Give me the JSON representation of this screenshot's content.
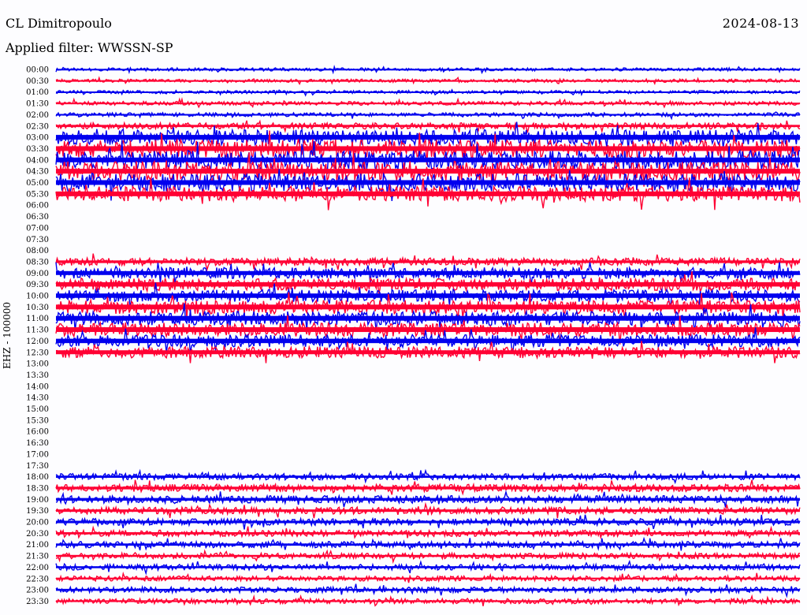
{
  "header": {
    "station": "CL Dimitropoulo",
    "date": "2024-08-13",
    "filter_label": "Applied filter: WWSSN-SP"
  },
  "colors": {
    "trace_a": "#0000ee",
    "trace_b": "#ff0033",
    "background": "#fdfdff",
    "text": "#000000"
  },
  "chart_data": {
    "type": "line",
    "title": "CL Dimitropoulo",
    "ylabel": "EHZ - 100000",
    "rows": [
      {
        "time": "00:00",
        "color": "trace_a",
        "amplitude": 0.25,
        "events": [
          {
            "x": 0.28,
            "height": 2.5,
            "dir": "up",
            "width": 0.03
          }
        ]
      },
      {
        "time": "00:30",
        "color": "trace_b",
        "amplitude": 0.25,
        "events": []
      },
      {
        "time": "01:00",
        "color": "trace_a",
        "amplitude": 0.25,
        "events": []
      },
      {
        "time": "01:30",
        "color": "trace_b",
        "amplitude": 0.3,
        "events": []
      },
      {
        "time": "02:00",
        "color": "trace_a",
        "amplitude": 0.3,
        "events": []
      },
      {
        "time": "02:30",
        "color": "trace_b",
        "amplitude": 0.5,
        "events": []
      },
      {
        "time": "03:00",
        "color": "trace_a",
        "amplitude": 1.2,
        "events": []
      },
      {
        "time": "03:30",
        "color": "trace_b",
        "amplitude": 1.4,
        "events": []
      },
      {
        "time": "04:00",
        "color": "trace_a",
        "amplitude": 1.5,
        "events": []
      },
      {
        "time": "04:30",
        "color": "trace_b",
        "amplitude": 1.6,
        "events": []
      },
      {
        "time": "05:00",
        "color": "trace_a",
        "amplitude": 1.4,
        "events": []
      },
      {
        "time": "05:30",
        "color": "trace_b",
        "amplitude": 1.2,
        "events": []
      },
      {
        "time": "06:00",
        "color": "trace_a",
        "amplitude": 0.0,
        "events": []
      },
      {
        "time": "06:30",
        "color": "trace_b",
        "amplitude": 0.0,
        "events": []
      },
      {
        "time": "07:00",
        "color": "trace_a",
        "amplitude": 0.0,
        "events": []
      },
      {
        "time": "07:30",
        "color": "trace_b",
        "amplitude": 0.0,
        "events": []
      },
      {
        "time": "08:00",
        "color": "trace_a",
        "amplitude": 0.0,
        "events": []
      },
      {
        "time": "08:30",
        "color": "trace_b",
        "amplitude": 0.6,
        "events": []
      },
      {
        "time": "09:00",
        "color": "trace_a",
        "amplitude": 0.9,
        "events": []
      },
      {
        "time": "09:30",
        "color": "trace_b",
        "amplitude": 1.0,
        "events": []
      },
      {
        "time": "10:00",
        "color": "trace_a",
        "amplitude": 1.0,
        "events": []
      },
      {
        "time": "10:30",
        "color": "trace_b",
        "amplitude": 1.1,
        "events": []
      },
      {
        "time": "11:00",
        "color": "trace_a",
        "amplitude": 1.1,
        "events": []
      },
      {
        "time": "11:30",
        "color": "trace_b",
        "amplitude": 1.1,
        "events": []
      },
      {
        "time": "12:00",
        "color": "trace_a",
        "amplitude": 1.0,
        "events": []
      },
      {
        "time": "12:30",
        "color": "trace_b",
        "amplitude": 0.9,
        "events": []
      },
      {
        "time": "13:00",
        "color": "trace_a",
        "amplitude": 0.0,
        "events": []
      },
      {
        "time": "13:30",
        "color": "trace_b",
        "amplitude": 0.0,
        "events": []
      },
      {
        "time": "14:00",
        "color": "trace_a",
        "amplitude": 0.0,
        "events": []
      },
      {
        "time": "14:30",
        "color": "trace_b",
        "amplitude": 0.0,
        "events": []
      },
      {
        "time": "15:00",
        "color": "trace_a",
        "amplitude": 0.0,
        "events": []
      },
      {
        "time": "15:30",
        "color": "trace_b",
        "amplitude": 0.0,
        "events": []
      },
      {
        "time": "16:00",
        "color": "trace_a",
        "amplitude": 0.0,
        "events": []
      },
      {
        "time": "16:30",
        "color": "trace_b",
        "amplitude": 0.0,
        "events": []
      },
      {
        "time": "17:00",
        "color": "trace_a",
        "amplitude": 0.0,
        "events": []
      },
      {
        "time": "17:30",
        "color": "trace_b",
        "amplitude": 0.0,
        "events": []
      },
      {
        "time": "18:00",
        "color": "trace_a",
        "amplitude": 0.5,
        "events": []
      },
      {
        "time": "18:30",
        "color": "trace_b",
        "amplitude": 0.6,
        "events": []
      },
      {
        "time": "19:00",
        "color": "trace_a",
        "amplitude": 0.6,
        "events": []
      },
      {
        "time": "19:30",
        "color": "trace_b",
        "amplitude": 0.55,
        "events": []
      },
      {
        "time": "20:00",
        "color": "trace_a",
        "amplitude": 0.55,
        "events": []
      },
      {
        "time": "20:30",
        "color": "trace_b",
        "amplitude": 0.5,
        "events": []
      },
      {
        "time": "21:00",
        "color": "trace_a",
        "amplitude": 0.5,
        "events": []
      },
      {
        "time": "21:30",
        "color": "trace_b",
        "amplitude": 0.45,
        "events": []
      },
      {
        "time": "22:00",
        "color": "trace_a",
        "amplitude": 0.45,
        "events": []
      },
      {
        "time": "22:30",
        "color": "trace_b",
        "amplitude": 0.4,
        "events": []
      },
      {
        "time": "23:00",
        "color": "trace_a",
        "amplitude": 0.45,
        "events": []
      },
      {
        "time": "23:30",
        "color": "trace_b",
        "amplitude": 0.4,
        "events": []
      }
    ]
  }
}
